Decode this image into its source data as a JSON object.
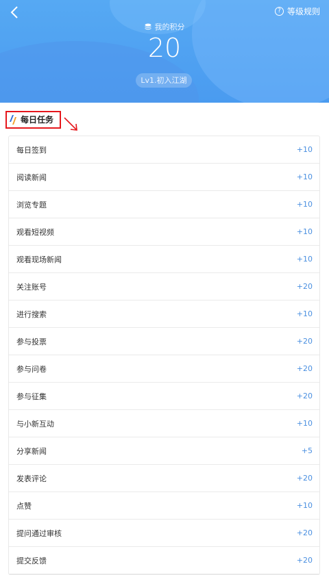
{
  "header": {
    "back_icon": "chevron-left-icon",
    "rules_label": "等级规则",
    "rules_icon": "question-circle-icon",
    "points_label": "我的积分",
    "points_icon": "coin-stack-icon",
    "points_value": "20",
    "level_badge": "Lv1.初入江湖"
  },
  "section": {
    "title": "每日任务",
    "title_icon": "slash-logo-icon",
    "annotation_color": "#e5161b"
  },
  "tasks": [
    {
      "name": "每日签到",
      "points": "+10"
    },
    {
      "name": "阅读新闻",
      "points": "+10"
    },
    {
      "name": "浏览专题",
      "points": "+10"
    },
    {
      "name": "观看短视频",
      "points": "+10"
    },
    {
      "name": "观看现场新闻",
      "points": "+10"
    },
    {
      "name": "关注账号",
      "points": "+20"
    },
    {
      "name": "进行搜索",
      "points": "+10"
    },
    {
      "name": "参与投票",
      "points": "+20"
    },
    {
      "name": "参与问卷",
      "points": "+20"
    },
    {
      "name": "参与征集",
      "points": "+20"
    },
    {
      "name": "与小新互动",
      "points": "+10"
    },
    {
      "name": "分享新闻",
      "points": "+5"
    },
    {
      "name": "发表评论",
      "points": "+20"
    },
    {
      "name": "点赞",
      "points": "+10"
    },
    {
      "name": "提问通过审核",
      "points": "+20"
    },
    {
      "name": "提交反馈",
      "points": "+20"
    }
  ]
}
